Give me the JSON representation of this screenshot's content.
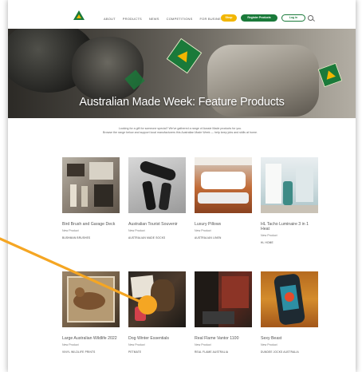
{
  "header": {
    "nav": [
      "About",
      "Products",
      "News",
      "Competitions",
      "For Business"
    ],
    "shop_label": "Shop",
    "register_label": "Register Products",
    "login_label": "Log in",
    "logo_icon": "triangle-logo-icon",
    "search_icon": "search-icon"
  },
  "hero": {
    "title": "Australian Made Week: Feature Products"
  },
  "intro": {
    "line1": "Looking for a gift for someone special? We've gathered a range of Aussie Made products for you.",
    "line2": "Browse the range below and support local manufacturers this Australian Made Week — help keep jobs and skills at home."
  },
  "products": [
    {
      "title": "Bird Brush and Garage Deck",
      "category": "New Product",
      "brand": "Bushman Brushes"
    },
    {
      "title": "Australian Tourist Souvenir",
      "category": "New Product",
      "brand": "Australian Made Socks"
    },
    {
      "title": "Luxury Pillows",
      "category": "New Product",
      "brand": "Australian Linen"
    },
    {
      "title": "HL Tacho Luminaire 3 in 1 Heat",
      "category": "New Product",
      "brand": "HL Home"
    },
    {
      "title": "Large Australian Wildlife 2022",
      "category": "New Product",
      "brand": "Vinyl Wildlife Prints"
    },
    {
      "title": "Dog Winter Essentials",
      "category": "New Product",
      "brand": "Petmate"
    },
    {
      "title": "Real Flame Vantor 1100",
      "category": "New Product",
      "brand": "Real Flame Australia"
    },
    {
      "title": "Sexy Beast",
      "category": "New Product",
      "brand": "Dundee Jocks Australia"
    }
  ],
  "colors": {
    "brand_green": "#1a7a3a",
    "brand_gold": "#f2b600",
    "pointer_orange": "#f5a623"
  }
}
